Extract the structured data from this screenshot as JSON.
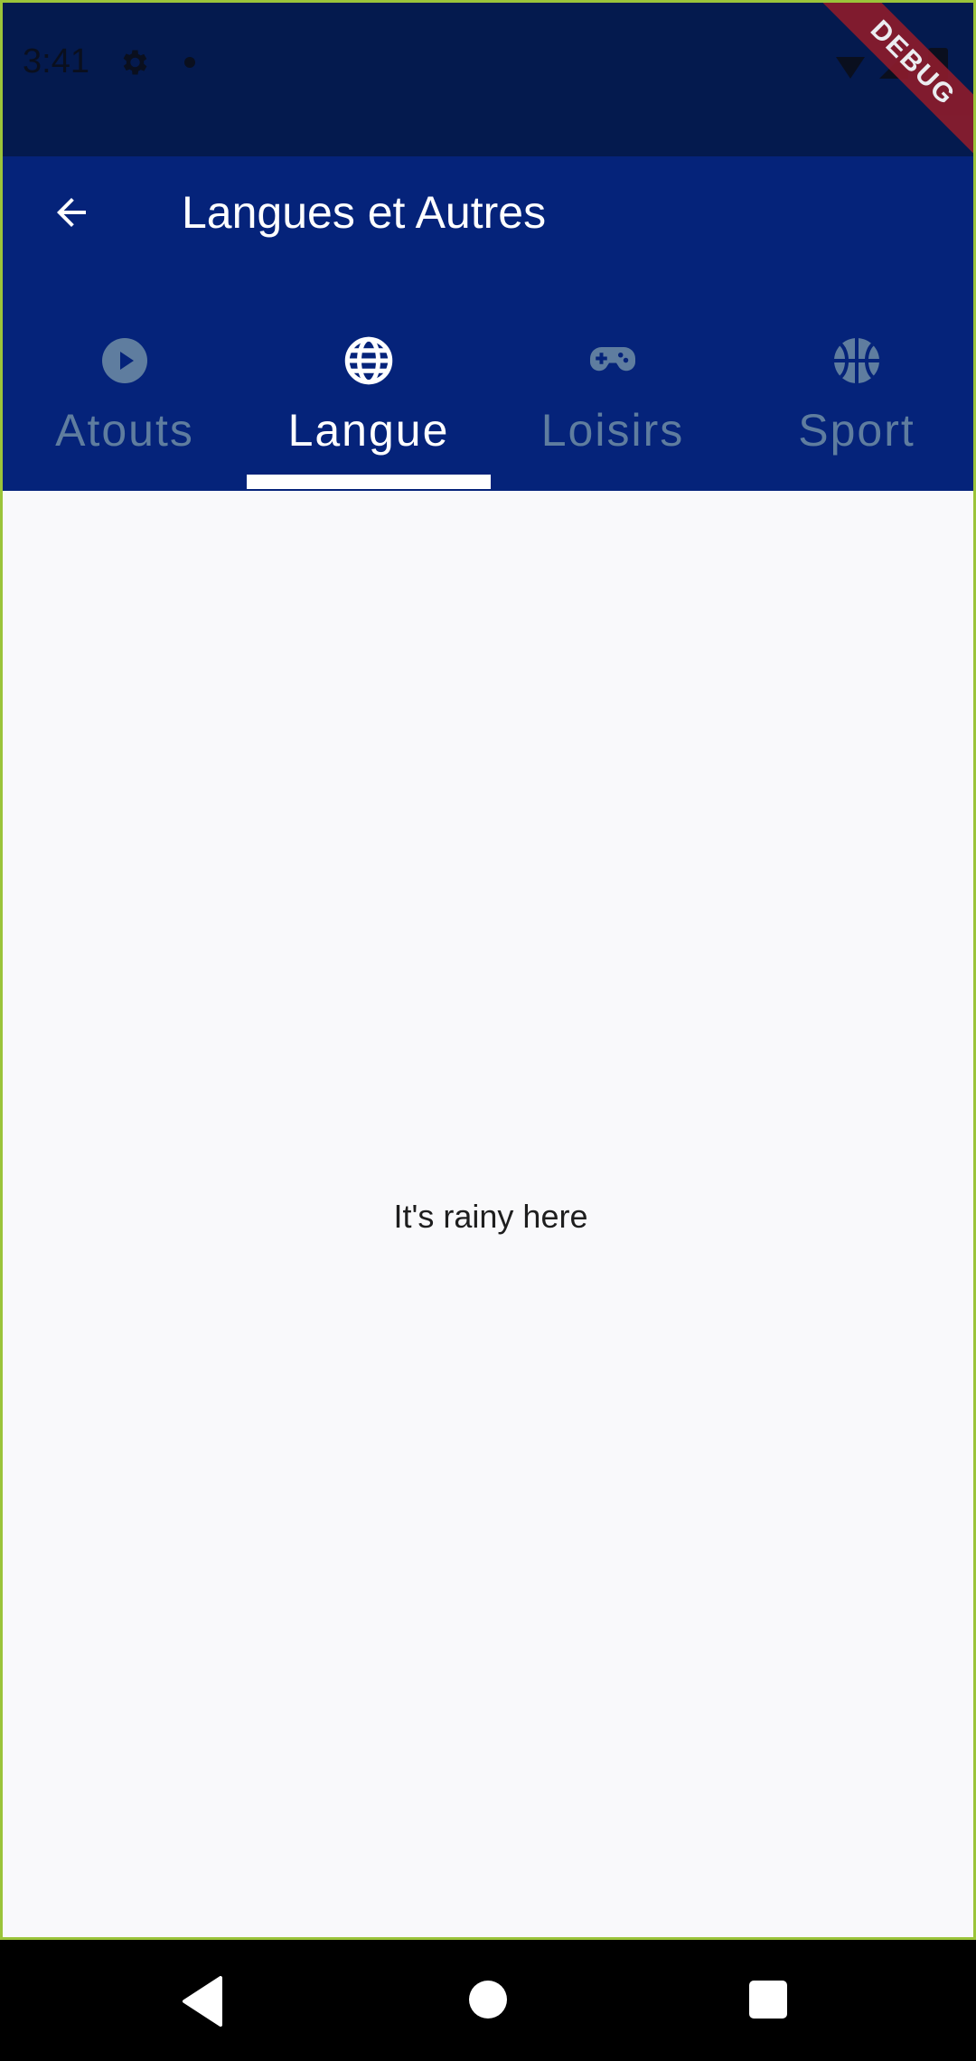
{
  "status_bar": {
    "time": "3:41",
    "debug_banner": "DEBUG"
  },
  "app_bar": {
    "title": "Langues et Autres",
    "background_color": "#05237a"
  },
  "tabs": [
    {
      "label": "Atouts",
      "icon": "play-circle-icon",
      "selected": false
    },
    {
      "label": "Langue",
      "icon": "globe-icon",
      "selected": true
    },
    {
      "label": "Loisirs",
      "icon": "gamepad-icon",
      "selected": false
    },
    {
      "label": "Sport",
      "icon": "basketball-icon",
      "selected": false
    }
  ],
  "content": {
    "message": "It's rainy here"
  },
  "colors": {
    "accent": "#05237a",
    "tab_inactive": "#5f7d9f",
    "tab_active": "#ffffff"
  }
}
